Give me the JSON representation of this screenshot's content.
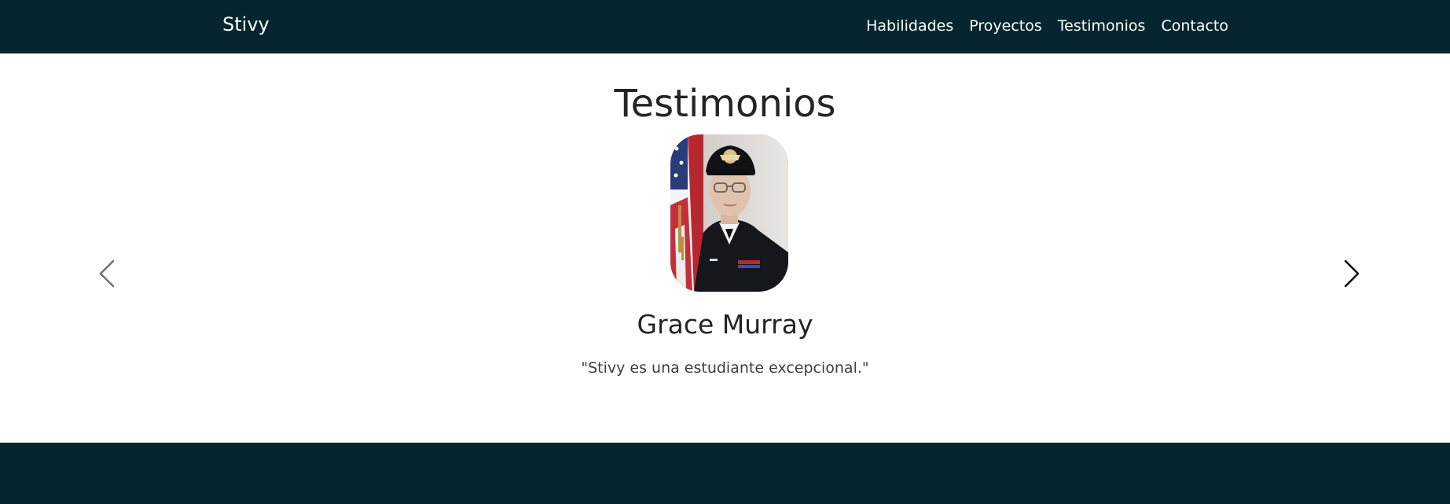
{
  "navbar": {
    "brand": "Stivy",
    "links": [
      "Habilidades",
      "Proyectos",
      "Testimonios",
      "Contacto"
    ]
  },
  "testimonials": {
    "title": "Testimonios",
    "active": {
      "name": "Grace Murray",
      "quote": "\"Stivy es una estudiante excepcional.\"",
      "photo": "portrait-photo"
    },
    "controls": {
      "prev_icon": "chevron-left-icon",
      "next_icon": "chevron-right-icon"
    }
  },
  "colors": {
    "navbar_bg": "#05262f",
    "footer_bg": "#05262f",
    "text": "#212529"
  }
}
